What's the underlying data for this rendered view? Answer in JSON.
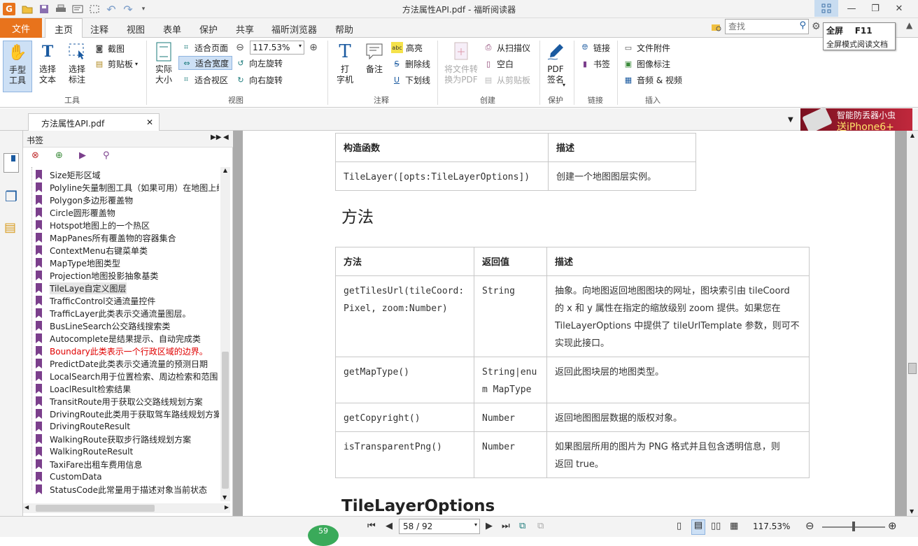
{
  "app": {
    "title": "方法属性API.pdf - 福昕阅读器"
  },
  "ribbon_tabs": [
    "文件",
    "主页",
    "注释",
    "视图",
    "表单",
    "保护",
    "共享",
    "福昕浏览器",
    "帮助"
  ],
  "search": {
    "placeholder": "查找"
  },
  "tooltip": {
    "title": "全屏",
    "shortcut": "F11",
    "desc": "全屏模式阅读文档"
  },
  "ribbon": {
    "tools": {
      "label": "工具",
      "hand": "手型\n工具",
      "hand_l1": "手型",
      "hand_l2": "工具",
      "select_text_l1": "选择",
      "select_text_l2": "文本",
      "select_ann_l1": "选择",
      "select_ann_l2": "标注",
      "snapshot": "截图",
      "clipboard": "剪贴板"
    },
    "view": {
      "label": "视图",
      "actual_l1": "实际",
      "actual_l2": "大小",
      "fit_page": "适合页面",
      "fit_width": "适合宽度",
      "fit_visible": "适合视区",
      "zoom": "117.53%",
      "rotate_left": "向左旋转",
      "rotate_right": "向右旋转"
    },
    "comment": {
      "label": "注释",
      "typewriter_l1": "打",
      "typewriter_l2": "字机",
      "note": "备注",
      "highlight": "高亮",
      "strikeout": "删除线",
      "underline": "下划线"
    },
    "create": {
      "label": "创建",
      "convert_l1": "将文件转",
      "convert_l2": "换为PDF",
      "from_scanner": "从扫描仪",
      "blank": "空白",
      "from_clipboard": "从剪贴板"
    },
    "protect": {
      "label": "保护",
      "sign_l1": "PDF",
      "sign_l2": "签名"
    },
    "links": {
      "label": "链接",
      "link": "链接",
      "bookmark": "书签"
    },
    "insert": {
      "label": "插入",
      "attachment": "文件附件",
      "image": "图像标注",
      "av": "音频 & 视频"
    }
  },
  "doc_tab": {
    "name": "方法属性API.pdf"
  },
  "ad": {
    "line1": "智能防丢器小虫",
    "line2": "送iPhone6+"
  },
  "bookmarks": {
    "header": "书签",
    "items": [
      {
        "label": "Size矩形区域"
      },
      {
        "label": "Polyline矢量制图工具（如果可用）在地图上绘"
      },
      {
        "label": "Polygon多边形覆盖物"
      },
      {
        "label": "Circle圆形覆盖物"
      },
      {
        "label": "Hotspot地图上的一个热区"
      },
      {
        "label": "MapPanes所有覆盖物的容器集合"
      },
      {
        "label": "ContextMenu右键菜单类"
      },
      {
        "label": "MapType地图类型"
      },
      {
        "label": "Projection地图投影抽象基类"
      },
      {
        "label": "TileLaye自定义图层",
        "selected": true
      },
      {
        "label": "TrafficControl交通流量控件"
      },
      {
        "label": "TrafficLayer此类表示交通流量图层。"
      },
      {
        "label": "BusLineSearch公交路线搜索类"
      },
      {
        "label": "Autocomplete是结果提示、自动完成类"
      },
      {
        "label": "Boundary此类表示一个行政区域的边界。",
        "red": true
      },
      {
        "label": "PredictDate此类表示交通流量的预测日期"
      },
      {
        "label": "LocalSearch用于位置检索、周边检索和范围"
      },
      {
        "label": "LoaclResult检索结果"
      },
      {
        "label": "TransitRoute用于获取公交路线规划方案"
      },
      {
        "label": "DrivingRoute此类用于获取驾车路线规划方案"
      },
      {
        "label": "DrivingRouteResult"
      },
      {
        "label": "WalkingRoute获取步行路线规划方案"
      },
      {
        "label": "WalkingRouteResult"
      },
      {
        "label": "TaxiFare出租车费用信息"
      },
      {
        "label": "CustomData"
      },
      {
        "label": "StatusCode此常量用于描述对象当前状态"
      }
    ]
  },
  "document": {
    "ctor_table": {
      "headers": [
        "构造函数",
        "描述"
      ],
      "rows": [
        [
          "TileLayer([opts:TileLayerOptions])",
          "创建一个地图图层实例。"
        ]
      ]
    },
    "methods_heading": "方法",
    "methods_table": {
      "headers": [
        "方法",
        "返回值",
        "描述"
      ],
      "rows": [
        {
          "m1": "getTilesUrl(tileCoord:",
          "m2": "Pixel, zoom:Number)",
          "r1": "String",
          "r2": "",
          "d1": "抽象。向地图返回地图图块的网址，图块索引由 tileCoord",
          "d2": "的 x 和 y 属性在指定的缩放级别 zoom 提供。如果您在",
          "d3": "TileLayerOptions 中提供了 tileUrlTemplate 参数，则可不",
          "d4": "实现此接口。"
        },
        {
          "m1": "getMapType()",
          "m2": "",
          "r1": "String|enu",
          "r2": "m MapType",
          "d1": "返回此图块层的地图类型。",
          "d2": "",
          "d3": "",
          "d4": ""
        },
        {
          "m1": "getCopyright()",
          "m2": "",
          "r1": "Number",
          "r2": "",
          "d1": "返回地图图层数据的版权对象。",
          "d2": "",
          "d3": "",
          "d4": ""
        },
        {
          "m1": "isTransparentPng()",
          "m2": "",
          "r1": "Number",
          "r2": "",
          "d1": "如果图层所用的图片为 PNG 格式并且包含透明信息，则",
          "d2": "返回 true。",
          "d3": "",
          "d4": ""
        }
      ]
    },
    "next_heading": "TileLayerOptions"
  },
  "status": {
    "page_field": "58 / 92",
    "zoom": "117.53%",
    "page_badge": "59"
  }
}
